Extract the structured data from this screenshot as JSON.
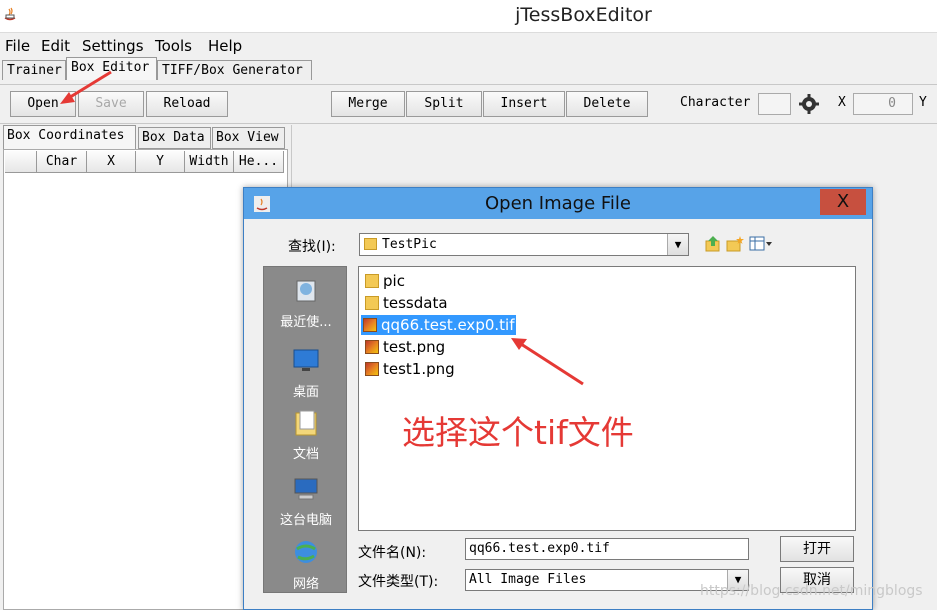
{
  "window": {
    "title": "jTessBoxEditor"
  },
  "menu": [
    "File",
    "Edit",
    "Settings",
    "Tools",
    "Help"
  ],
  "main_tabs": [
    "Trainer",
    "Box Editor",
    "TIFF/Box Generator"
  ],
  "toolbar": {
    "open": "Open",
    "save": "Save",
    "reload": "Reload",
    "merge": "Merge",
    "split": "Split",
    "insert": "Insert",
    "delete": "Delete",
    "character_label": "Character",
    "x_label": "X",
    "x_value": "0",
    "y_label": "Y"
  },
  "left_tabs": [
    "Box Coordinates",
    "Box Data",
    "Box View"
  ],
  "table_headers": [
    "Char",
    "X",
    "Y",
    "Width",
    "He..."
  ],
  "dialog": {
    "title": "Open Image File",
    "close": "X",
    "look_in_label": "查找(I):",
    "look_in_value": "TestPic",
    "places": [
      "最近使...",
      "桌面",
      "文档",
      "这台电脑",
      "网络"
    ],
    "files": [
      {
        "name": "pic",
        "type": "folder"
      },
      {
        "name": "tessdata",
        "type": "folder"
      },
      {
        "name": "qq66.test.exp0.tif",
        "type": "image"
      },
      {
        "name": "test.png",
        "type": "image"
      },
      {
        "name": "test1.png",
        "type": "image"
      }
    ],
    "filename_label": "文件名(N):",
    "filename_value": "qq66.test.exp0.tif",
    "filetype_label": "文件类型(T):",
    "filetype_value": "All Image Files",
    "open_button": "打开",
    "cancel_button": "取消"
  },
  "annotation": "选择这个tif文件",
  "watermark": "https://blog.csdn.net/mingblogs",
  "colors": {
    "accent": "#3399ff",
    "dialog_title": "#57a3e8",
    "close": "#c7503f",
    "annotation": "#e53935"
  }
}
